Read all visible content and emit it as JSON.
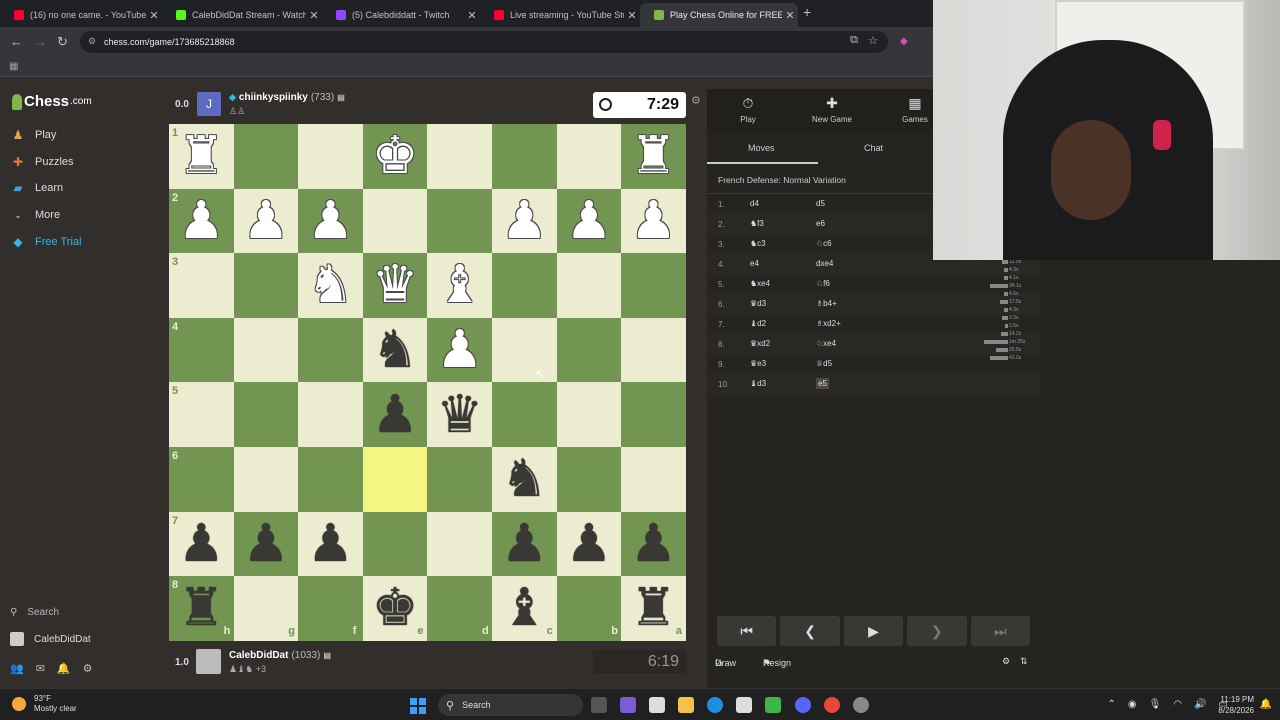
{
  "browser": {
    "tabs": [
      {
        "title": "(16) no one came. - YouTube",
        "fav": "#ff0033"
      },
      {
        "title": "CalebDidDat Stream - Watch Li...",
        "fav": "#53fc18"
      },
      {
        "title": "(5) Calebdiddatt - Twitch",
        "fav": "#9146ff"
      },
      {
        "title": "Live streaming - YouTube Studi...",
        "fav": "#ff0033"
      },
      {
        "title": "Play Chess Online for FREE - 2 P...",
        "fav": "#81b64c"
      }
    ],
    "url": "chess.com/game/173685218868"
  },
  "sidebar": {
    "brand": "Chess",
    "brand_suffix": ".com",
    "items": [
      {
        "label": "Play",
        "icon": "play-icon",
        "color": "#f0a04b"
      },
      {
        "label": "Puzzles",
        "icon": "puzzle-icon",
        "color": "#e5733b"
      },
      {
        "label": "Learn",
        "icon": "learn-icon",
        "color": "#3ba4e0"
      },
      {
        "label": "More",
        "icon": "chevron-down-icon",
        "color": "#ddd"
      },
      {
        "label": "Free Trial",
        "icon": "diamond-icon",
        "color": "#37b5e8"
      }
    ],
    "search_label": "Search",
    "username": "CalebDidDat"
  },
  "top_player": {
    "score": "0.0",
    "avatar_letter": "J",
    "name": "chiinkyspiinky",
    "rating": "(733)",
    "clock": "7:29"
  },
  "bottom_player": {
    "score": "1.0",
    "name": "CalebDidDat",
    "rating": "(1033)",
    "material": "+3",
    "clock": "6:19"
  },
  "board": {
    "ranks": [
      "1",
      "2",
      "3",
      "4",
      "5",
      "6",
      "7",
      "8"
    ],
    "files": [
      "h",
      "g",
      "f",
      "e",
      "d",
      "c",
      "b",
      "a"
    ],
    "highlight": [
      [
        5,
        3
      ]
    ],
    "pieces": [
      {
        "r": 0,
        "c": 0,
        "p": "♜",
        "side": "w"
      },
      {
        "r": 0,
        "c": 3,
        "p": "♚",
        "side": "w"
      },
      {
        "r": 0,
        "c": 7,
        "p": "♜",
        "side": "w"
      },
      {
        "r": 1,
        "c": 0,
        "p": "♟",
        "side": "w"
      },
      {
        "r": 1,
        "c": 1,
        "p": "♟",
        "side": "w"
      },
      {
        "r": 1,
        "c": 2,
        "p": "♟",
        "side": "w"
      },
      {
        "r": 1,
        "c": 5,
        "p": "♟",
        "side": "w"
      },
      {
        "r": 1,
        "c": 6,
        "p": "♟",
        "side": "w"
      },
      {
        "r": 1,
        "c": 7,
        "p": "♟",
        "side": "w"
      },
      {
        "r": 2,
        "c": 2,
        "p": "♞",
        "side": "w"
      },
      {
        "r": 2,
        "c": 3,
        "p": "♛",
        "side": "w"
      },
      {
        "r": 2,
        "c": 4,
        "p": "♝",
        "side": "w"
      },
      {
        "r": 3,
        "c": 3,
        "p": "♞",
        "side": "b"
      },
      {
        "r": 3,
        "c": 4,
        "p": "♟",
        "side": "w"
      },
      {
        "r": 4,
        "c": 3,
        "p": "♟",
        "side": "b"
      },
      {
        "r": 4,
        "c": 4,
        "p": "♛",
        "side": "b"
      },
      {
        "r": 5,
        "c": 5,
        "p": "♞",
        "side": "b"
      },
      {
        "r": 6,
        "c": 0,
        "p": "♟",
        "side": "b"
      },
      {
        "r": 6,
        "c": 1,
        "p": "♟",
        "side": "b"
      },
      {
        "r": 6,
        "c": 2,
        "p": "♟",
        "side": "b"
      },
      {
        "r": 6,
        "c": 5,
        "p": "♟",
        "side": "b"
      },
      {
        "r": 6,
        "c": 6,
        "p": "♟",
        "side": "b"
      },
      {
        "r": 6,
        "c": 7,
        "p": "♟",
        "side": "b"
      },
      {
        "r": 7,
        "c": 0,
        "p": "♜",
        "side": "b"
      },
      {
        "r": 7,
        "c": 3,
        "p": "♚",
        "side": "b"
      },
      {
        "r": 7,
        "c": 5,
        "p": "♝",
        "side": "b"
      },
      {
        "r": 7,
        "c": 7,
        "p": "♜",
        "side": "b"
      }
    ]
  },
  "panel": {
    "tabs": [
      {
        "label": "Play",
        "icon": "stopwatch-icon"
      },
      {
        "label": "New Game",
        "icon": "plus-icon"
      },
      {
        "label": "Games",
        "icon": "board-icon"
      }
    ],
    "subtabs": [
      "Moves",
      "Chat"
    ],
    "opening": "French Defense: Normal Variation",
    "moves": [
      {
        "n": "1.",
        "w": "d4",
        "b": "d5"
      },
      {
        "n": "2.",
        "w": "♞f3",
        "b": "e6"
      },
      {
        "n": "3.",
        "w": "♞c3",
        "b": "♘c6"
      },
      {
        "n": "4.",
        "w": "e4",
        "b": "dxe4"
      },
      {
        "n": "5.",
        "w": "♞xe4",
        "b": "♘f6"
      },
      {
        "n": "6.",
        "w": "♛d3",
        "b": "♗b4+"
      },
      {
        "n": "7.",
        "w": "♝d2",
        "b": "♗xd2+"
      },
      {
        "n": "8.",
        "w": "♛xd2",
        "b": "♘xe4"
      },
      {
        "n": "9.",
        "w": "♛e3",
        "b": "♕d5"
      },
      {
        "n": "10.",
        "w": "♝d3",
        "b": "e5"
      }
    ],
    "times": [
      "12.5s",
      "4.3s",
      "4.1s",
      "34.1s",
      "4.6s",
      "17.5s",
      "4.3s",
      "9.3s",
      "2.5s",
      "14.2s",
      "1m 25s",
      "25.5s",
      "42.0s"
    ],
    "draw_label": "Draw",
    "draw_prefix": "½",
    "resign_label": "Resign"
  },
  "taskbar": {
    "temp": "93°F",
    "weather": "Mostly clear",
    "search": "Search",
    "time": "11:19 PM",
    "date": "8/28/2026"
  }
}
